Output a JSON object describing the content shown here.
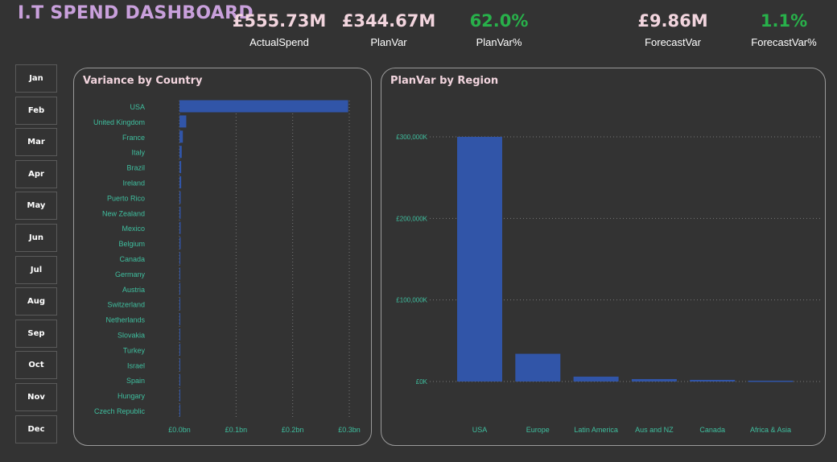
{
  "title": "I.T SPEND DASHBOARD",
  "kpis": {
    "actual_spend": {
      "value": "£555.73M",
      "label": "ActualSpend"
    },
    "plan_var": {
      "value": "£344.67M",
      "label": "PlanVar"
    },
    "plan_var_pct": {
      "value": "62.0%",
      "label": "PlanVar%"
    },
    "forecast_var": {
      "value": "£9.86M",
      "label": "ForecastVar"
    },
    "forecast_var_pct": {
      "value": "1.1%",
      "label": "ForecastVar%"
    }
  },
  "months": [
    "Jan",
    "Feb",
    "Mar",
    "Apr",
    "May",
    "Jun",
    "Jul",
    "Aug",
    "Sep",
    "Oct",
    "Nov",
    "Dec"
  ],
  "colors": {
    "bar": "#3155a8",
    "axis_text": "#3fbf9f",
    "title": "#c9a0dc",
    "kpi": "#f2d5de",
    "positive": "#28b04a"
  },
  "chart_data": [
    {
      "type": "bar",
      "orientation": "horizontal",
      "title": "Variance by Country",
      "categories": [
        "USA",
        "United Kingdom",
        "France",
        "Italy",
        "Brazil",
        "Ireland",
        "Puerto Rico",
        "New Zealand",
        "Mexico",
        "Belgium",
        "Canada",
        "Germany",
        "Austria",
        "Switzerland",
        "Netherlands",
        "Slovakia",
        "Turkey",
        "Israel",
        "Spain",
        "Hungary",
        "Czech Republic"
      ],
      "values": [
        0.298,
        0.012,
        0.006,
        0.004,
        0.003,
        0.003,
        0.002,
        0.002,
        0.002,
        0.002,
        0.0015,
        0.0012,
        0.001,
        0.001,
        0.0009,
        0.0008,
        0.0007,
        0.0006,
        0.0005,
        0.0005,
        0.0004
      ],
      "unit": "bn",
      "xlim": [
        0,
        0.3
      ],
      "xticks": [
        "£0.0bn",
        "£0.1bn",
        "£0.2bn",
        "£0.3bn"
      ],
      "grid": true
    },
    {
      "type": "bar",
      "title": "PlanVar by Region",
      "categories": [
        "USA",
        "Europe",
        "Latin America",
        "Aus and NZ",
        "Canada",
        "Africa & Asia"
      ],
      "values": [
        300000,
        34000,
        6000,
        3000,
        2000,
        1000
      ],
      "unit": "K",
      "ylim": [
        0,
        300000
      ],
      "yticks": [
        "£0K",
        "£100,000K",
        "£200,000K",
        "£300,000K"
      ],
      "grid": true
    }
  ]
}
